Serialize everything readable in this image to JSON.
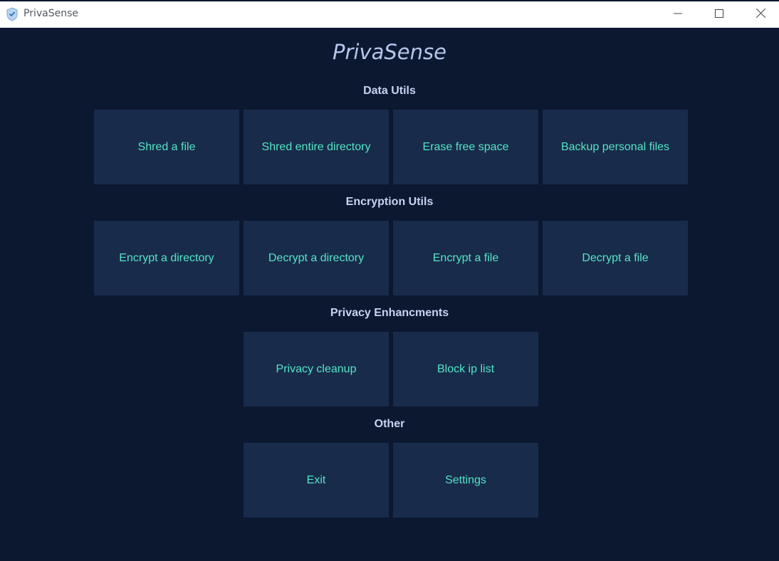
{
  "window": {
    "title": "PrivaSense",
    "icon": "shield-check-icon",
    "controls": [
      "minimize-icon",
      "maximize-icon",
      "close-icon"
    ]
  },
  "app": {
    "heading": "PrivaSense"
  },
  "sections": [
    {
      "title": "Data Utils",
      "buttons": [
        "Shred a file",
        "Shred entire directory",
        "Erase free space",
        "Backup personal files"
      ]
    },
    {
      "title": "Encryption Utils",
      "buttons": [
        "Encrypt a directory",
        "Decrypt a directory",
        "Encrypt a file",
        "Decrypt a file"
      ]
    },
    {
      "title": "Privacy Enhancments",
      "buttons": [
        "Privacy cleanup",
        "Block ip list"
      ]
    },
    {
      "title": "Other",
      "buttons": [
        "Exit",
        "Settings"
      ]
    }
  ],
  "colors": {
    "background": "#0b1830",
    "tile": "#182b4a",
    "tile_text": "#54e5c6",
    "heading": "#b6c6ec",
    "section_title": "#c7d3f1"
  }
}
